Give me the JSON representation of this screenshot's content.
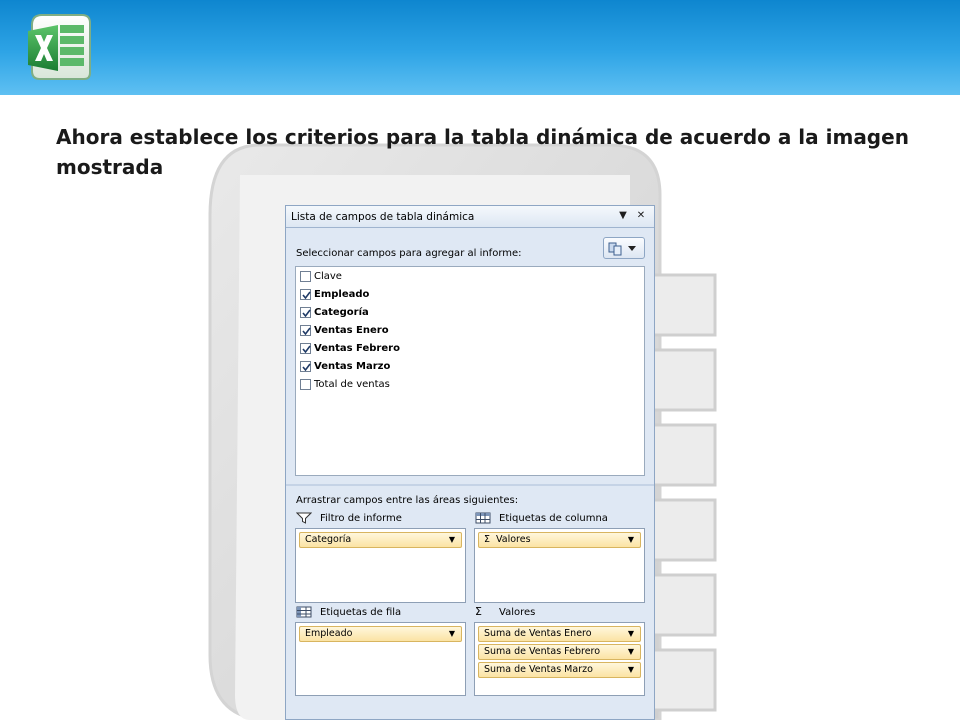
{
  "slide": {
    "title": "Ahora establece  los criterios para la tabla dinámica de acuerdo a la imagen mostrada"
  },
  "logo": {
    "icon": "excel-logo-icon",
    "color": "#1f8a3b"
  },
  "panel": {
    "title": "Lista de campos de tabla dinámica",
    "dropdown_glyph": "▼",
    "close_glyph": "✕",
    "select_fields_label": "Seleccionar campos para agregar al informe:",
    "fields": [
      {
        "label": "Clave",
        "checked": false
      },
      {
        "label": "Empleado",
        "checked": true
      },
      {
        "label": "Categoría",
        "checked": true
      },
      {
        "label": "Ventas Enero",
        "checked": true
      },
      {
        "label": "Ventas Febrero",
        "checked": true
      },
      {
        "label": "Ventas Marzo",
        "checked": true
      },
      {
        "label": "Total de ventas",
        "checked": false
      }
    ],
    "drag_label": "Arrastrar campos entre las áreas siguientes:",
    "areas": {
      "report_filter": {
        "label": "Filtro de informe",
        "items": [
          "Categoría"
        ]
      },
      "column_labels": {
        "label": "Etiquetas de columna",
        "items": [
          "Valores"
        ]
      },
      "row_labels": {
        "label": "Etiquetas de fila",
        "items": [
          "Empleado"
        ]
      },
      "values": {
        "label": "Valores",
        "items": [
          "Suma de Ventas Enero",
          "Suma de Ventas Febrero",
          "Suma de Ventas Marzo"
        ]
      }
    },
    "sigma_glyph": "Σ",
    "pill_dropdown_glyph": "▼"
  },
  "colors": {
    "banner": "#1a95dc",
    "panel_bg": "#dfe8f4",
    "pill": "#fbe3a4"
  }
}
